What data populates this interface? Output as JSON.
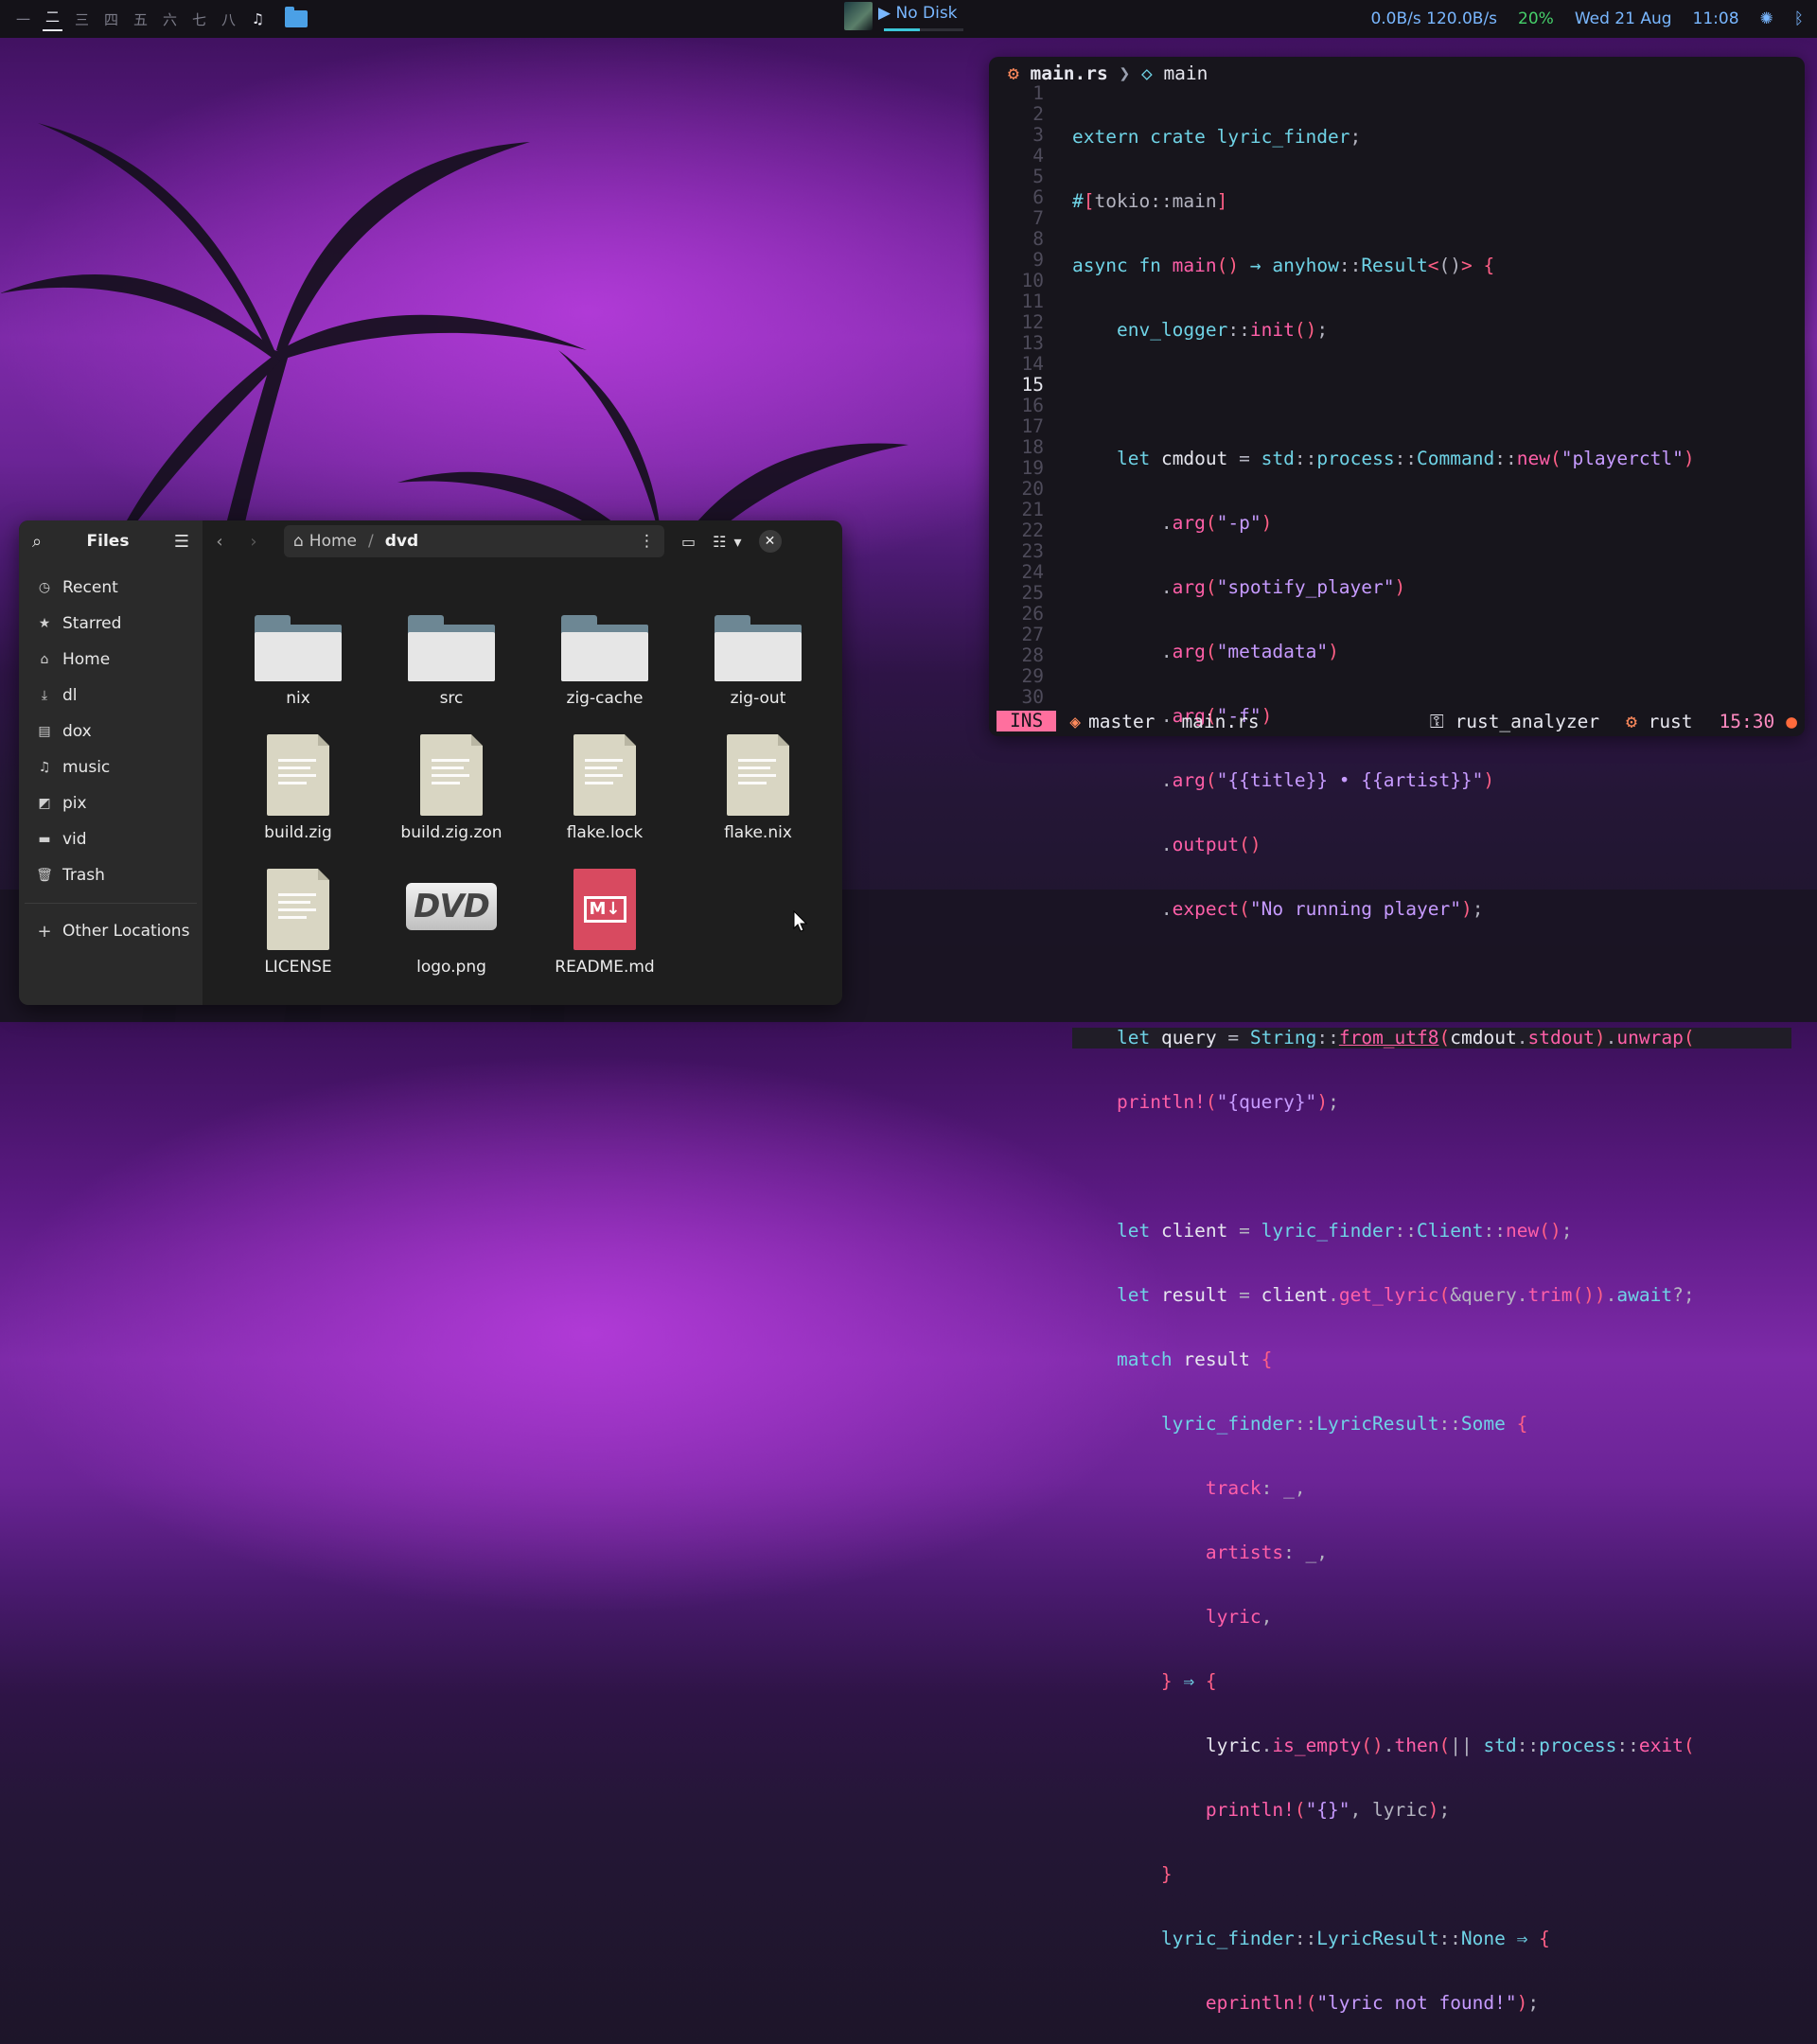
{
  "topbar": {
    "workspaces": [
      "一",
      "二",
      "三",
      "四",
      "五",
      "六",
      "七",
      "八"
    ],
    "active_workspace": "二",
    "media_title": "▶ No Disk",
    "media_progress": 0.45,
    "network": "0.0B/s 120.0B/s",
    "battery": "20%",
    "date": "Wed 21 Aug",
    "time": "11:08"
  },
  "editor": {
    "breadcrumb_file": "main.rs",
    "breadcrumb_symbol": "main",
    "current_line": 15,
    "line_numbers": [
      "1",
      "2",
      "3",
      "4",
      "5",
      "6",
      "7",
      "8",
      "9",
      "10",
      "11",
      "12",
      "13",
      "14",
      "15",
      "16",
      "17",
      "18",
      "19",
      "20",
      "21",
      "22",
      "23",
      "24",
      "25",
      "26",
      "27",
      "28",
      "29",
      "30"
    ],
    "status": {
      "mode": "INS",
      "branch": "master",
      "file": "main.rs",
      "lsp": "rust_analyzer",
      "lang": "rust",
      "position": "15:30"
    }
  },
  "files": {
    "app_title": "Files",
    "sidebar": [
      {
        "icon": "clock-icon",
        "label": "Recent"
      },
      {
        "icon": "star-icon",
        "label": "Starred"
      },
      {
        "icon": "home-icon",
        "label": "Home"
      },
      {
        "icon": "download-icon",
        "label": "dl"
      },
      {
        "icon": "document-icon",
        "label": "dox"
      },
      {
        "icon": "music-icon",
        "label": "music"
      },
      {
        "icon": "picture-icon",
        "label": "pix"
      },
      {
        "icon": "video-icon",
        "label": "vid"
      },
      {
        "icon": "trash-icon",
        "label": "Trash"
      }
    ],
    "other_locations": "Other Locations",
    "path_home": "Home",
    "path_current": "dvd",
    "items": [
      {
        "name": "nix",
        "kind": "folder"
      },
      {
        "name": "src",
        "kind": "folder"
      },
      {
        "name": "zig-cache",
        "kind": "folder"
      },
      {
        "name": "zig-out",
        "kind": "folder"
      },
      {
        "name": "build.zig",
        "kind": "text"
      },
      {
        "name": "build.zig.zon",
        "kind": "text"
      },
      {
        "name": "flake.lock",
        "kind": "text"
      },
      {
        "name": "flake.nix",
        "kind": "text"
      },
      {
        "name": "LICENSE",
        "kind": "text"
      },
      {
        "name": "logo.png",
        "kind": "image"
      },
      {
        "name": "README.md",
        "kind": "markdown"
      }
    ]
  }
}
